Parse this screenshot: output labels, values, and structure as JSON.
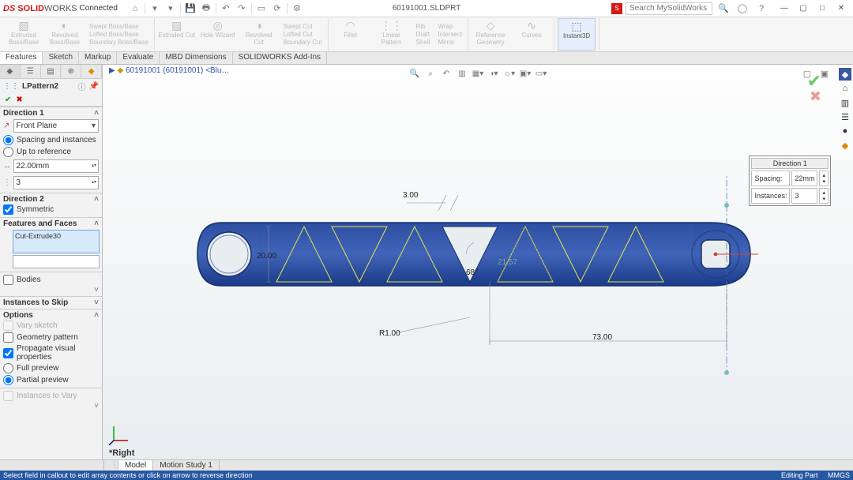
{
  "app": {
    "brand": "SOLID",
    "brand2": "WORKS",
    "edition": "Connected"
  },
  "doc_title": "60191001.SLDPRT",
  "search_placeholder": "Search MySolidWorks",
  "ribbon": {
    "g1": {
      "b1": "Extruded Boss/Base",
      "b2": "Revolved Boss/Base",
      "l1": "Swept Boss/Base",
      "l2": "Lofted Boss/Base",
      "l3": "Boundary Boss/Base"
    },
    "g2": {
      "b1": "Extruded Cut",
      "b2": "Hole Wizard",
      "b3": "Revolved Cut",
      "l1": "Swept Cut",
      "l2": "Lofted Cut",
      "l3": "Boundary Cut"
    },
    "g3": {
      "b1": "Fillet",
      "b2": "Linear Pattern",
      "l1": "Rib",
      "l2": "Draft",
      "l3": "Shell",
      "l4": "Wrap",
      "l5": "Intersect",
      "l6": "Mirror"
    },
    "g4": {
      "b1": "Reference Geometry",
      "b2": "Curves"
    },
    "g5": {
      "b1": "Instant3D"
    }
  },
  "cmdtabs": [
    "Features",
    "Sketch",
    "Markup",
    "Evaluate",
    "MBD Dimensions",
    "SOLIDWORKS Add-Ins"
  ],
  "breadcrumb": "60191001 (60191001) <Blu…",
  "feature": {
    "name": "LPattern2",
    "dir1": {
      "title": "Direction 1",
      "plane": "Front Plane",
      "radio1": "Spacing and instances",
      "radio2": "Up to reference",
      "spacing": "22.00mm",
      "count": "3"
    },
    "dir2": {
      "title": "Direction 2",
      "sym": "Symmetric"
    },
    "ff": {
      "title": "Features and Faces",
      "item": "Cut-Extrude30"
    },
    "bodies": "Bodies",
    "skip": "Instances to Skip",
    "opts": {
      "title": "Options",
      "o1": "Vary sketch",
      "o2": "Geometry pattern",
      "o3": "Propagate visual properties",
      "o4": "Full preview",
      "o5": "Partial preview"
    },
    "vary": "Instances to Vary"
  },
  "callout": {
    "title": "Direction 1",
    "r1": "Spacing:",
    "v1": "22mm",
    "r2": "Instances:",
    "v2": "3"
  },
  "dims": {
    "d1": "3.00",
    "d2": "20.00",
    "d3": "68°",
    "d4": "R1.00",
    "d5": "73.00",
    "d6": "21.57"
  },
  "viewlabel": "*Right",
  "btabs": {
    "t1": "Model",
    "t2": "Motion Study 1"
  },
  "status": {
    "left": "Select field in callout to edit array contents or click on arrow to reverse direction",
    "right1": "Editing Part",
    "right2": "MMGS"
  }
}
